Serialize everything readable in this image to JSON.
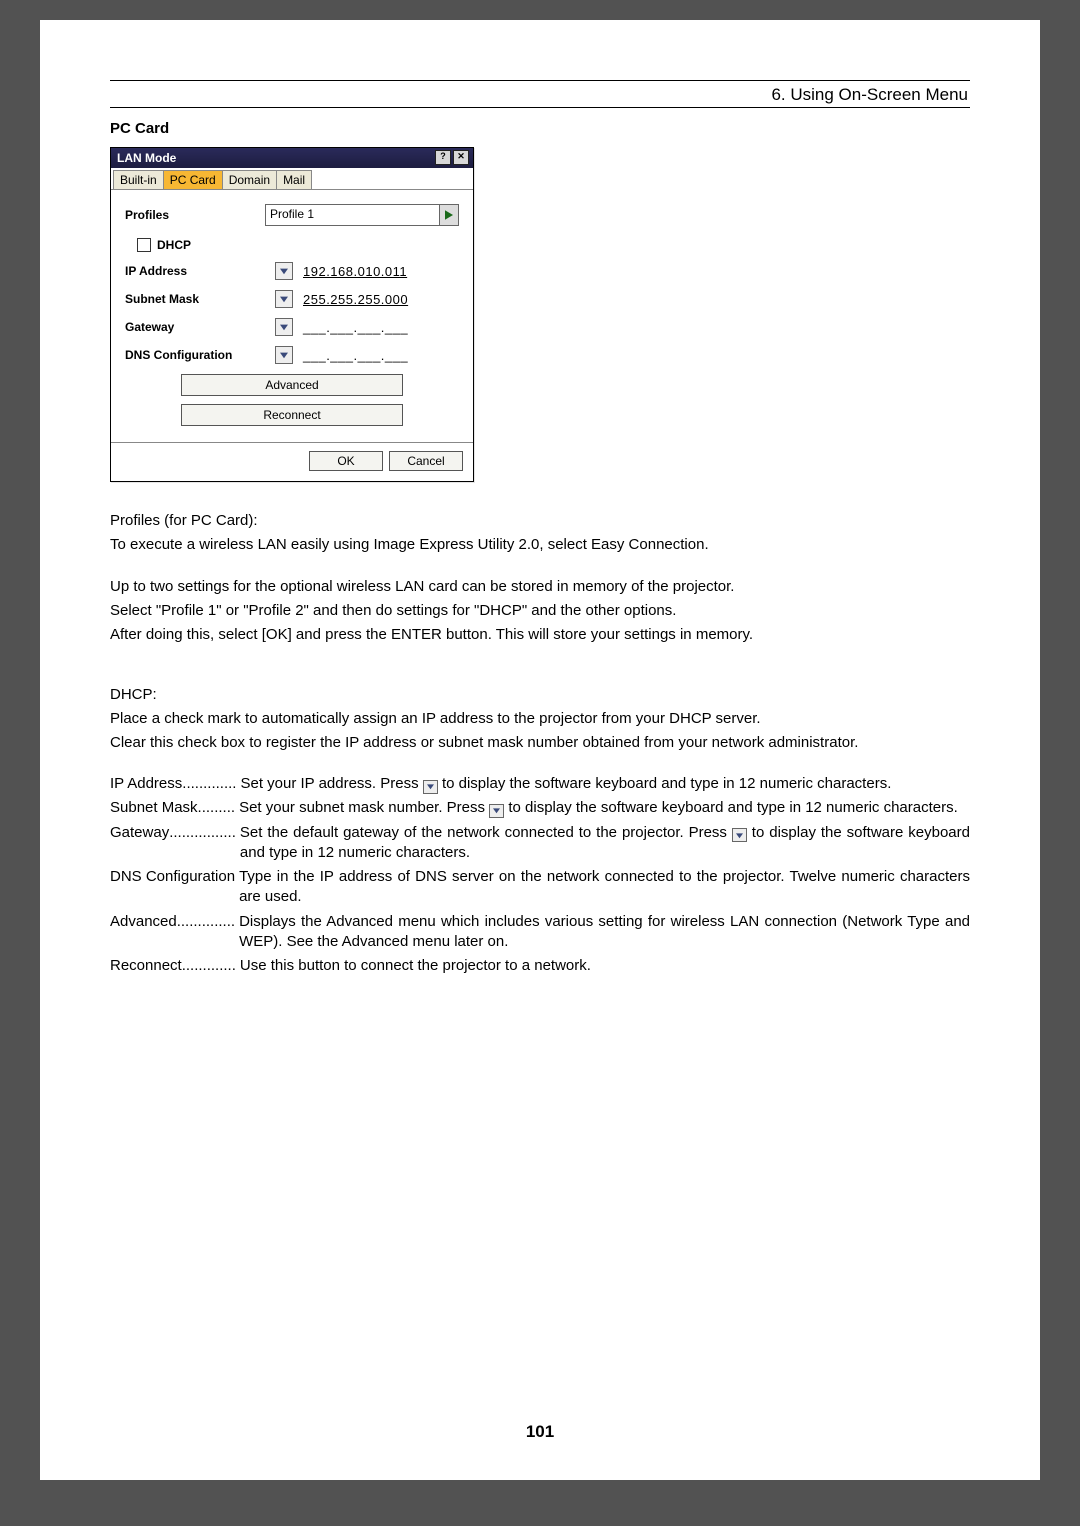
{
  "header": {
    "chapter": "6. Using On-Screen Menu"
  },
  "section_title": "PC Card",
  "dialog": {
    "title": "LAN Mode",
    "help_btn": "?",
    "close_btn": "✕",
    "tabs": {
      "builtin": "Built-in",
      "pccard": "PC Card",
      "domain": "Domain",
      "mail": "Mail"
    },
    "profiles_label": "Profiles",
    "profiles_value": "Profile 1",
    "dhcp_label": "DHCP",
    "ip_label": "IP Address",
    "ip_value": "192.168.010.011",
    "subnet_label": "Subnet Mask",
    "subnet_value": "255.255.255.000",
    "gateway_label": "Gateway",
    "gateway_value": "___.___.___.___",
    "dns_label": "DNS Configuration",
    "dns_value": "___.___.___.___",
    "advanced_btn": "Advanced",
    "reconnect_btn": "Reconnect",
    "ok_btn": "OK",
    "cancel_btn": "Cancel"
  },
  "body": {
    "p1": "Profiles (for PC Card):",
    "p2": "To execute a wireless LAN easily using Image Express Utility 2.0, select  Easy Connection.",
    "p3": "Up to two settings for the optional wireless LAN card can be stored in memory of the projector.",
    "p4": "Select \"Profile 1\" or \"Profile 2\" and then do settings for \"DHCP\" and the other options.",
    "p5": "After doing this, select [OK] and press the ENTER button. This will store your settings in memory.",
    "p6": "DHCP:",
    "p7": "Place a check mark to automatically assign an IP address to the projector from your DHCP server.",
    "p8": "Clear this check box to register the IP address or subnet mask number obtained from your network administrator."
  },
  "defs": {
    "ip": {
      "term": "IP Address",
      "dots": " ............. ",
      "d1": "Set your IP address. Press ",
      "d2": " to display the software keyboard and type in 12 numeric characters."
    },
    "subnet": {
      "term": "Subnet Mask",
      "dots": " ......... ",
      "d1": "Set your subnet mask number. Press ",
      "d2": " to display the software keyboard and type in 12 numeric characters."
    },
    "gateway": {
      "term": "Gateway",
      "dots": " ................ ",
      "d1": "Set the default gateway of the network connected to the projector. Press ",
      "d2": " to display the software keyboard and type in 12 numeric characters."
    },
    "dns": {
      "term": "DNS Configuration",
      "dots": "  ",
      "d1": "Type in the IP address of DNS server on the network connected to the projector. Twelve numeric characters are used."
    },
    "advanced": {
      "term": "Advanced",
      "dots": " .............. ",
      "d1": "Displays the Advanced menu which includes various setting for wireless LAN connection (Network Type and WEP). See the Advanced menu later on."
    },
    "reconnect": {
      "term": "Reconnect",
      "dots": " ............. ",
      "d1": "Use this button to connect the projector to a network."
    }
  },
  "page_number": "101"
}
